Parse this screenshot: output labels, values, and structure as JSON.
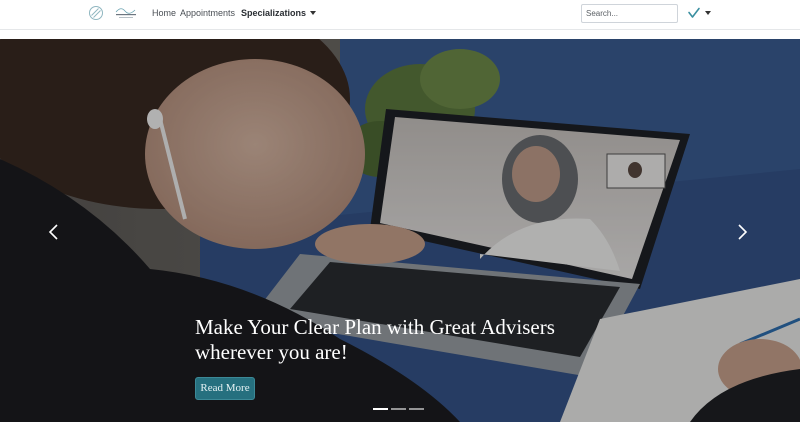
{
  "nav": {
    "home": "Home",
    "appointments": "Appointments",
    "specializations": "Specializations"
  },
  "search": {
    "placeholder": "Search..."
  },
  "hero": {
    "title_line1": "Make Your Clear Plan with Great Advisers",
    "title_line2": "wherever you are!",
    "button": "Read More",
    "slides": 3,
    "active_slide": 1
  },
  "colors": {
    "accent": "#26707f",
    "brand_check": "#3a8fa0"
  },
  "icons": {
    "logo": "circle-slash-logo",
    "prev": "chevron-left-icon",
    "next": "chevron-right-icon",
    "user": "check-icon"
  }
}
